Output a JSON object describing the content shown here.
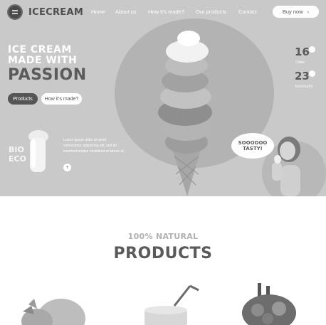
{
  "brand": {
    "name": "ICECREAM"
  },
  "nav": {
    "items": [
      "Home",
      "About us",
      "How it's made?",
      "Our products",
      "Contact"
    ],
    "buy_label": "Buy now",
    "buy_icon": "chevron-right-icon"
  },
  "hero": {
    "headline_line1": "ICE CREAM",
    "headline_line2": "MADE WITH",
    "headline_big": "PASSION",
    "products_button": "Products",
    "how_made_button": "How it's made?",
    "bio_line1": "BIO",
    "bio_line2": "ECO",
    "lorem": "Lorem ipsum dolor sit amet, consectetur adipiscing elit, sed do eiusmod tempor incididunt ut labore et",
    "bubble_line1": "SOOOOOO",
    "bubble_line2": "TASTY!"
  },
  "stats": [
    {
      "value": "16",
      "label": "Cafes"
    },
    {
      "value": "23",
      "label": "food trucks"
    }
  ],
  "products_section": {
    "kicker": "100% NATURAL",
    "title": "PRODUCTS"
  },
  "colors": {
    "hero_bg": "#c9c9c9",
    "dark": "#555555",
    "white": "#ffffff"
  }
}
